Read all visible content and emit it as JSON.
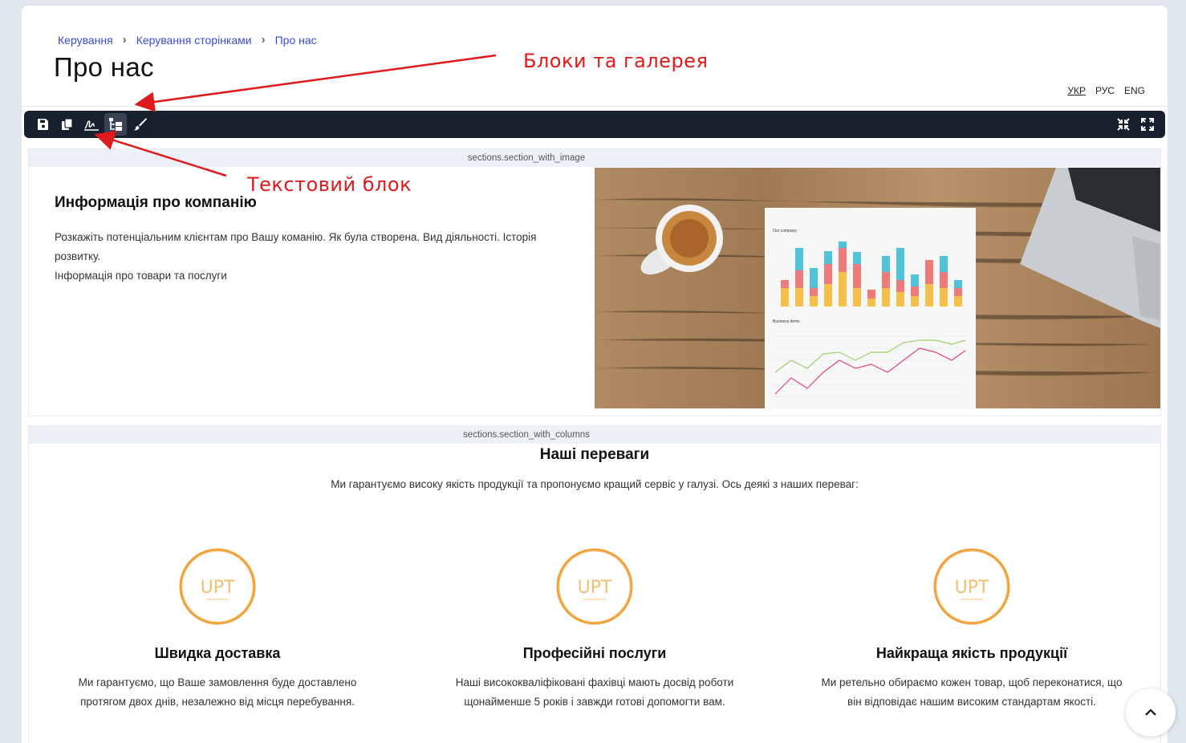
{
  "breadcrumb": {
    "item1": "Керування",
    "item2": "Керування сторінками",
    "item3": "Про нас"
  },
  "page": {
    "title": "Про нас"
  },
  "languages": {
    "ukr": "УКР",
    "rus": "РУС",
    "eng": "ENG",
    "active": "УКР"
  },
  "toolbar": {
    "icons": [
      "save-icon",
      "copy-icon",
      "signature-icon",
      "blocks-tree-icon",
      "brush-icon",
      "compress-icon",
      "expand-icon"
    ]
  },
  "section1": {
    "label": "sections.section_with_image",
    "heading": "Информація про компанію",
    "paragraph1": "Розкажіть потенціальним клієнтам про Вашу команію. Як була створена. Вид діяльності. Історія розвитку.",
    "paragraph2": "Інформація про товари та послуги",
    "photo": {
      "chart1_title": "Our company",
      "chart2_title": "Business items"
    }
  },
  "section2": {
    "label": "sections.section_with_columns",
    "heading": "Наші переваги",
    "subtitle": "Ми гарантуємо високу якість продукції та пропонуємо кращий сервіс у галузі. Ось деякі з наших переваг:",
    "features": [
      {
        "badge": "UPT",
        "title": "Швидка доставка",
        "text": "Ми гарантуємо, що Ваше замовлення буде доставлено протягом двох днів, незалежно від місця перебування."
      },
      {
        "badge": "UPT",
        "title": "Професійні послуги",
        "text": "Наші висококваліфіковані фахівці мають досвід роботи щонайменше 5 років і завжди готові допомогти вам."
      },
      {
        "badge": "UPT",
        "title": "Найкраща якість продукції",
        "text": "Ми ретельно обираємо кожен товар, щоб переконатися, що він відповідає нашим високим стандартам якості."
      }
    ]
  },
  "annotations": {
    "blocks": "Блоки та галерея",
    "text_block": "Текстовий блок"
  },
  "colors": {
    "accent": "#3b4bd1",
    "toolbar": "#18202e",
    "annotation": "#e0191b",
    "badge": "#f0a23a"
  }
}
